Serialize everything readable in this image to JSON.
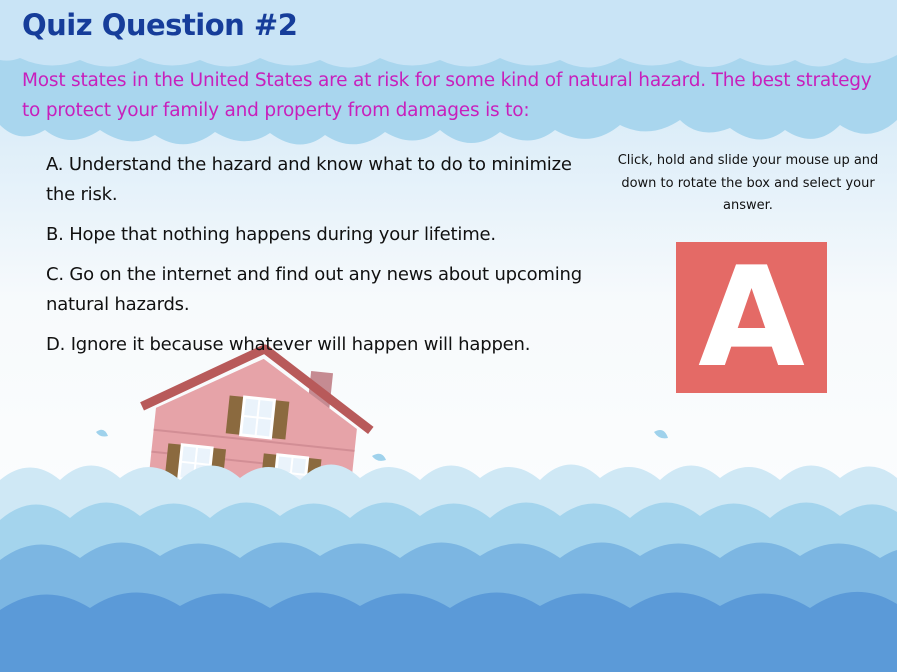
{
  "quiz": {
    "title": "Quiz Question #2",
    "question": "Most states in the United States are at risk for some kind of natural hazard. The best strategy to protect your family and property from damages is to:",
    "options": [
      "A. Understand the hazard and know what to do to minimize the risk.",
      "B. Hope that nothing happens during your lifetime.",
      "C. Go on the internet and find out any news about upcoming natural hazards.",
      "D. Ignore it because whatever will happen will happen."
    ],
    "instructions": "Click, hold and slide your mouse up and down to rotate the box and select your answer.",
    "selected_answer": "A"
  },
  "colors": {
    "title": "#163d9a",
    "question": "#c81fbc",
    "answer_box": "#e46a66",
    "sky": "#c9e4f6",
    "cloud": "#a9d6ee",
    "water_light": "#9fd2ec",
    "water_dark": "#5b9ad8",
    "house": "#e6a3a8",
    "roof": "#b85a5a"
  },
  "icons": [
    "cloud-decoration",
    "flooded-house-illustration",
    "water-waves-decoration"
  ]
}
